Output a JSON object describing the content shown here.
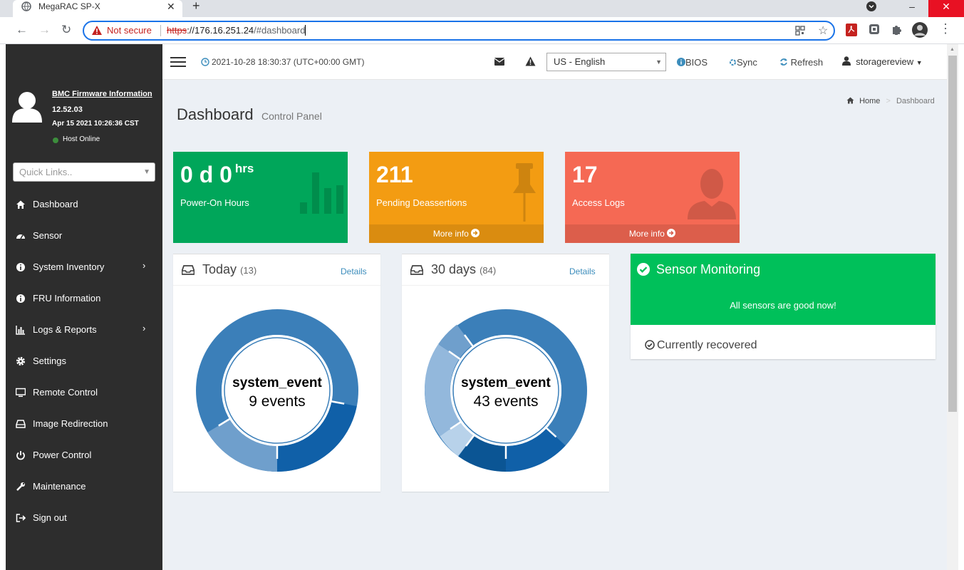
{
  "browser": {
    "tab_title": "MegaRAC SP-X",
    "tab_close": "✕",
    "new_tab": "+",
    "security_label": "Not secure",
    "url_scheme": "https",
    "url_host": "://176.16.251.24",
    "url_path": "/#dashboard"
  },
  "sidebar": {
    "fw_title": "BMC Firmware Information",
    "fw_version": "12.52.03",
    "fw_date": "Apr 15 2021 10:26:36 CST",
    "host_status": "Host Online",
    "quick_links_placeholder": "Quick Links..",
    "items": [
      {
        "label": "Dashboard",
        "icon": "home-icon"
      },
      {
        "label": "Sensor",
        "icon": "dashboard-gauge-icon"
      },
      {
        "label": "System Inventory",
        "icon": "info-icon",
        "has_submenu": true
      },
      {
        "label": "FRU Information",
        "icon": "info-icon"
      },
      {
        "label": "Logs & Reports",
        "icon": "bar-chart-icon",
        "has_submenu": true
      },
      {
        "label": "Settings",
        "icon": "gear-icon"
      },
      {
        "label": "Remote Control",
        "icon": "monitor-icon"
      },
      {
        "label": "Image Redirection",
        "icon": "drive-icon"
      },
      {
        "label": "Power Control",
        "icon": "power-icon"
      },
      {
        "label": "Maintenance",
        "icon": "wrench-icon"
      },
      {
        "label": "Sign out",
        "icon": "sign-out-icon"
      }
    ]
  },
  "topbar": {
    "datetime": "2021-10-28 18:30:37 (UTC+00:00 GMT)",
    "language": "US - English",
    "bios_label": "BIOS",
    "sync_label": "Sync",
    "refresh_label": "Refresh",
    "user_label": "storagereview"
  },
  "page": {
    "title": "Dashboard",
    "subtitle": "Control Panel",
    "breadcrumb_home": "Home",
    "breadcrumb_current": "Dashboard"
  },
  "stat_boxes": [
    {
      "value": "0 d 0",
      "unit": "hrs",
      "label": "Power-On Hours",
      "color": "#00a65a"
    },
    {
      "value": "211",
      "label": "Pending Deassertions",
      "footer": "More info",
      "color": "#f39c12"
    },
    {
      "value": "17",
      "label": "Access Logs",
      "footer": "More info",
      "color": "#f56954"
    }
  ],
  "event_panels": [
    {
      "title": "Today",
      "count": "(13)",
      "details": "Details",
      "center_name": "system_event",
      "center_count": "9 events"
    },
    {
      "title": "30 days",
      "count": "(84)",
      "details": "Details",
      "center_name": "system_event",
      "center_count": "43 events"
    }
  ],
  "sensor_panel": {
    "title": "Sensor Monitoring",
    "status": "All sensors are good now!",
    "recovered": "Currently recovered",
    "color": "#00c05a"
  }
}
